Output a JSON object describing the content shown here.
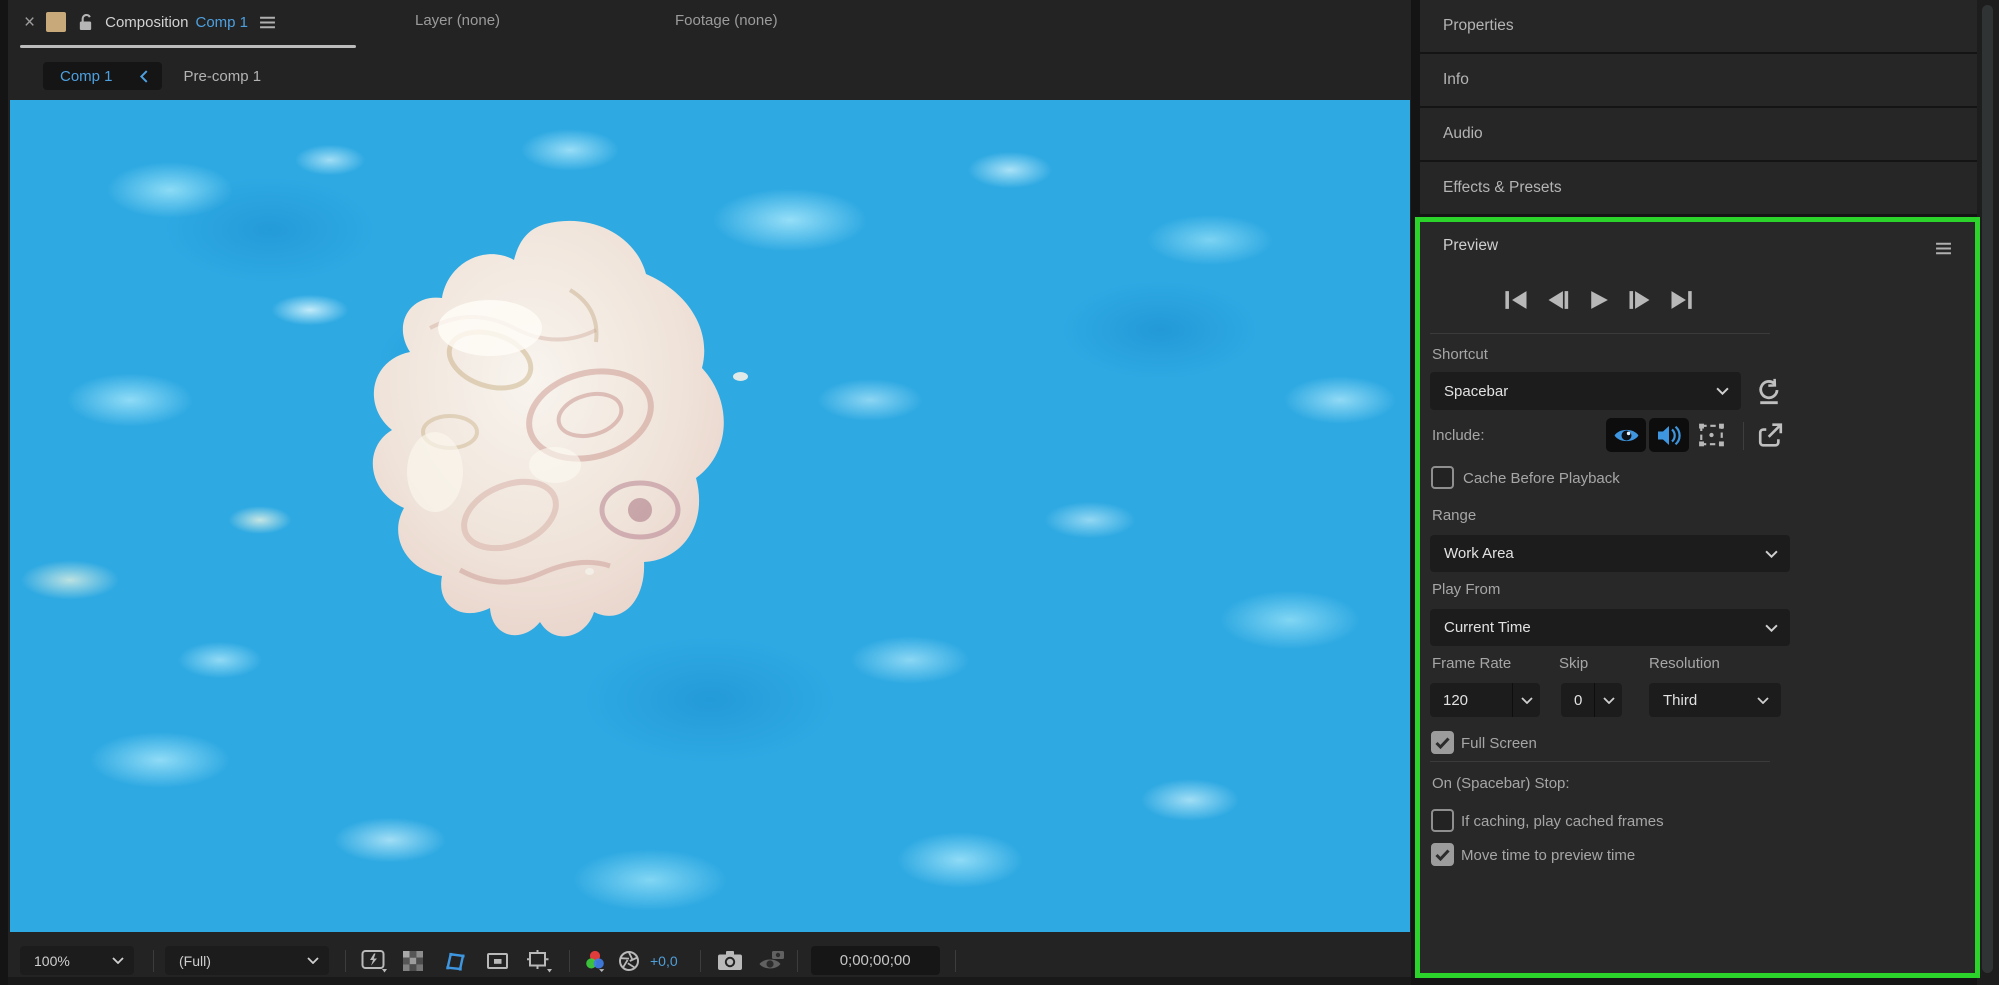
{
  "tabs": {
    "close_glyph": "×",
    "composition_label": "Composition",
    "composition_name": "Comp 1",
    "layer": "Layer (none)",
    "footage": "Footage (none)"
  },
  "breadcrumb": {
    "current": "Comp 1",
    "parent": "Pre-comp 1"
  },
  "sidebar": {
    "items": [
      {
        "label": "Properties"
      },
      {
        "label": "Info"
      },
      {
        "label": "Audio"
      },
      {
        "label": "Effects & Presets"
      }
    ]
  },
  "preview": {
    "title": "Preview",
    "shortcut_label": "Shortcut",
    "shortcut_value": "Spacebar",
    "include_label": "Include:",
    "include_video_on": true,
    "include_audio_on": true,
    "include_overlays_on": false,
    "cache_label": "Cache Before Playback",
    "cache_checked": false,
    "range_label": "Range",
    "range_value": "Work Area",
    "play_from_label": "Play From",
    "play_from_value": "Current Time",
    "frame_rate_label": "Frame Rate",
    "frame_rate_value": "120",
    "skip_label": "Skip",
    "skip_value": "0",
    "resolution_label": "Resolution",
    "resolution_value": "Third",
    "full_screen_label": "Full Screen",
    "full_screen_checked": true,
    "on_stop_label": "On (Spacebar) Stop:",
    "if_caching_label": "If caching, play cached frames",
    "if_caching_checked": false,
    "move_time_label": "Move time to preview time",
    "move_time_checked": true
  },
  "toolbar": {
    "zoom_value": "100%",
    "resolution_value": "(Full)",
    "exposure_value": "+0,0",
    "timecode": "0;00;00;00"
  },
  "icons": {
    "playback": [
      "first-frame",
      "previous-frame",
      "play",
      "next-frame",
      "last-frame"
    ],
    "include": [
      "video-eye",
      "audio-speaker",
      "overlays-layer-controls",
      "primary-viewer"
    ],
    "toolbar": [
      "fast-previews",
      "transparency-grid",
      "mask-visibility",
      "region-of-interest",
      "guide-options",
      "channel-rgb",
      "exposure-aperture",
      "snapshot-camera",
      "show-snapshot",
      "reset"
    ]
  },
  "colors": {
    "accent_blue": "#4da0e0",
    "highlight_green": "#2bd32b",
    "water_blue": "#2ea9e2",
    "panel_bg": "#232323",
    "control_bg": "#1c1c1c"
  }
}
